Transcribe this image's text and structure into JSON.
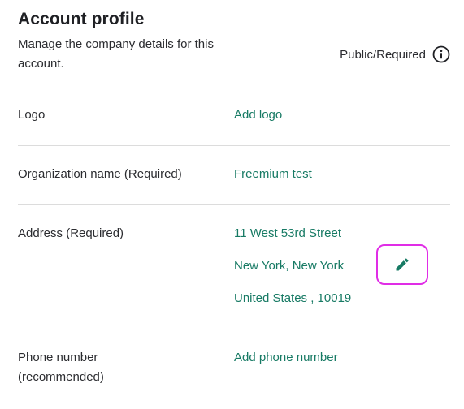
{
  "header": {
    "title": "Account profile",
    "subtitle": "Manage the company details for this account.",
    "visibility_label": "Public/Required",
    "info_icon": "info-circle-icon"
  },
  "fields": {
    "logo": {
      "label": "Logo",
      "value": "Add logo"
    },
    "organization_name": {
      "label": "Organization name (Required)",
      "value": "Freemium test"
    },
    "address": {
      "label": "Address (Required)",
      "line1": "11 West 53rd Street",
      "line2": "New York, New York",
      "line3": "United States , 10019",
      "edit_icon": "pencil-icon"
    },
    "phone": {
      "label_line1": "Phone number",
      "label_line2": "(recommended)",
      "value": "Add phone number"
    }
  },
  "colors": {
    "link": "#177a64",
    "edit_highlight": "#e02de6",
    "divider": "#dcdcdc"
  }
}
